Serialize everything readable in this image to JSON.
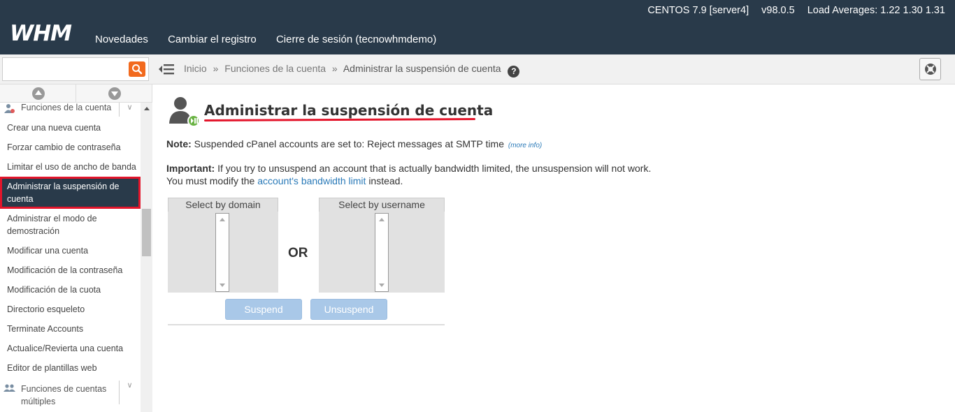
{
  "app": {
    "logo": "WHM",
    "nav": [
      "Novedades",
      "Cambiar el registro",
      "Cierre de sesión (tecnowhmdemo)"
    ],
    "system": {
      "os": "CENTOS 7.9 [server4]",
      "version": "v98.0.5",
      "load_label": "Load Averages: 1.22 1.30 1.31"
    }
  },
  "search": {
    "placeholder": "",
    "value": ""
  },
  "breadcrumb": {
    "items": [
      "Inicio",
      "Funciones de la cuenta",
      "Administrar la suspensión de cuenta"
    ],
    "separator": "»"
  },
  "sidebar": {
    "category": "Funciones de la cuenta",
    "items": [
      "Crear una nueva cuenta",
      "Forzar cambio de contraseña",
      "Limitar el uso de ancho de banda",
      "Administrar la suspensión de cuenta",
      "Administrar el modo de demostración",
      "Modificar una cuenta",
      "Modificación de la contraseña",
      "Modificación de la cuota",
      "Directorio esqueleto",
      "Terminate Accounts",
      "Actualice/Revierta una cuenta",
      "Editor de plantillas web"
    ],
    "next_category": "Funciones de cuentas múltiples"
  },
  "main": {
    "title": "Administrar la suspensión de cuenta",
    "note_label": "Note:",
    "note_text": "Suspended cPanel accounts are set to: Reject messages at SMTP time",
    "more_info": "(more info)",
    "important_label": "Important:",
    "important_text_1": "If you try to unsuspend an account that is actually bandwidth limited, the unsuspension will not work. You must modify the",
    "important_link": "account's bandwidth limit",
    "important_text_2": "instead.",
    "select_domain": "Select by domain",
    "select_username": "Select by username",
    "or": "OR",
    "suspend": "Suspend",
    "unsuspend": "Unsuspend"
  },
  "colors": {
    "header_bg": "#293a4a",
    "accent_red": "#e3152b",
    "search_orange": "#f26a1e",
    "link_blue": "#2a7ab8",
    "button_disabled": "#a9c8e8"
  }
}
